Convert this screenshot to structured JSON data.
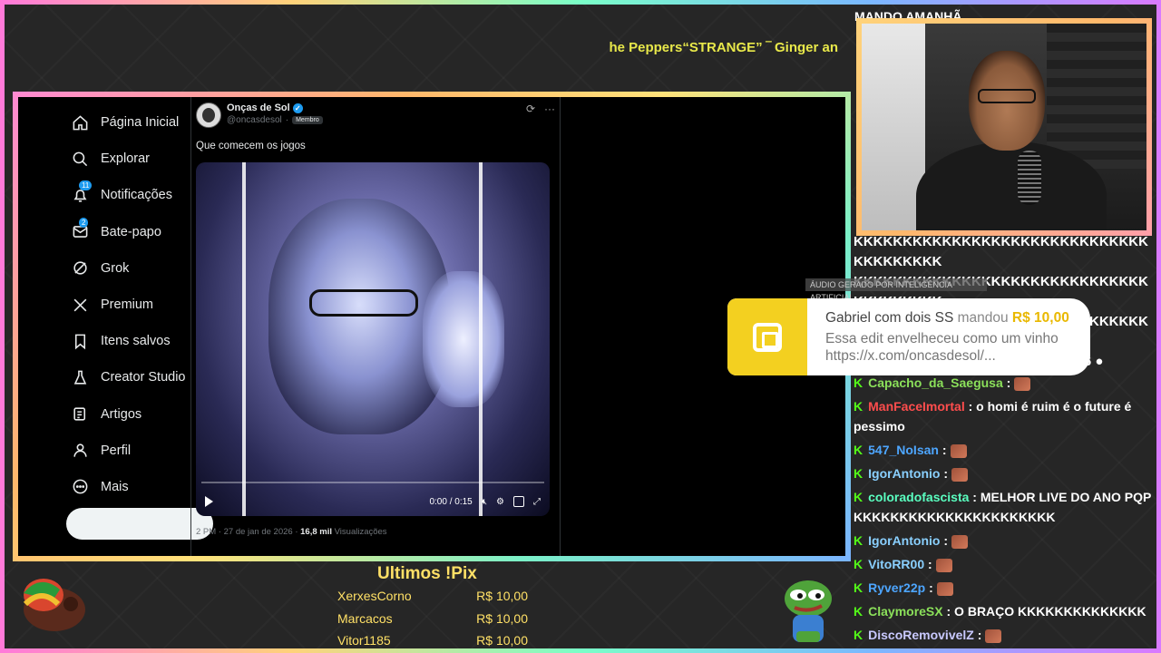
{
  "ticker": {
    "text": "he Peppers“STRANGE”  ‾  Ginger an"
  },
  "chat_header": "MANDO AMANHÃ",
  "twitter": {
    "nav": [
      {
        "label": "Página Inicial",
        "icon": "home-icon"
      },
      {
        "label": "Explorar",
        "icon": "search-icon"
      },
      {
        "label": "Notificações",
        "icon": "bell-icon",
        "badge": "11"
      },
      {
        "label": "Bate-papo",
        "icon": "mail-icon",
        "badge": "2"
      },
      {
        "label": "Grok",
        "icon": "grok-icon"
      },
      {
        "label": "Premium",
        "icon": "x-icon"
      },
      {
        "label": "Itens salvos",
        "icon": "bookmark-icon"
      },
      {
        "label": "Creator Studio",
        "icon": "flask-icon"
      },
      {
        "label": "Artigos",
        "icon": "article-icon"
      },
      {
        "label": "Perfil",
        "icon": "person-icon"
      },
      {
        "label": "Mais",
        "icon": "more-icon"
      }
    ],
    "post": {
      "author": "Onças de Sol",
      "handle": "@oncasdesol",
      "tag": "Membro",
      "text": "Que comecem os jogos",
      "video_time": "0:00 / 0:15",
      "meta_time": "2 PM · 27 de jan de 2026 · ",
      "views_count": "16,8 mil",
      "views_label": " Visualizações"
    }
  },
  "chat": {
    "spam_lines": [
      "KKKKKKKKKKKKKKKKKKKKKKKKKKKKKKKKKKKKKKK",
      "KKKKKKKKKKKKKKKKKKKKKKKKKKKKKKKKKKKKKKK",
      "KKKKKKKKKKKKKKKKKKKKKKKKKKKKKKKKKKKKKKK",
      "mito 26 ● mito 26 ● mito 26 ● mito 26 ●"
    ],
    "messages": [
      {
        "user": "Capacho_da_Saegusa",
        "color": "#8be05a",
        "text": ":",
        "emote": true
      },
      {
        "user": "ManFaceImortal",
        "color": "#ff4d4d",
        "text": ": o homi é ruim é o future é pessimo",
        "emote": false
      },
      {
        "user": "547_NoIsan",
        "color": "#4da6ff",
        "text": ":",
        "emote": true
      },
      {
        "user": "IgorAntonio",
        "color": "#8ad0ff",
        "text": ":",
        "emote": true
      },
      {
        "user": "coloradofascista",
        "color": "#5affc0",
        "text": ": MELHOR LIVE DO ANO PQP KKKKKKKKKKKKKKKKKKKKKK",
        "emote": false
      },
      {
        "user": "IgorAntonio",
        "color": "#8ad0ff",
        "text": ":",
        "emote": true
      },
      {
        "user": "VitoRR00",
        "color": "#8ad0ff",
        "text": ":",
        "emote": true
      },
      {
        "user": "Ryver22p",
        "color": "#4da6ff",
        "text": ":",
        "emote": true
      },
      {
        "user": "ClaymoreSX",
        "color": "#8be05a",
        "text": ": O BRAÇO KKKKKKKKKKKKKK",
        "emote": false
      },
      {
        "user": "DiscoRemovivelZ",
        "color": "#c9c9ff",
        "text": ":",
        "emote": true
      }
    ]
  },
  "donation": {
    "ai_label": "ÁUDIO GERADO POR INTELIGÊNCIA ARTIFICIAL",
    "name": "Gabriel com dois SS",
    "verb": " mandou ",
    "amount": "R$ 10,00",
    "text": "Essa edit envelheceu como um vinho https://x.com/oncasdesol/..."
  },
  "pix": {
    "title": "Ultimos !Pix",
    "rows": [
      {
        "name": "XerxesCorno",
        "amount": "R$ 10,00"
      },
      {
        "name": "Marcacos",
        "amount": "R$ 10,00"
      },
      {
        "name": "Vitor1185",
        "amount": "R$ 10,00"
      }
    ]
  },
  "colors": {
    "accent_yellow": "#ffe066",
    "kick_green": "#53fc18",
    "twitter_blue": "#1d9bf0",
    "pix_yellow": "#f3d020"
  }
}
